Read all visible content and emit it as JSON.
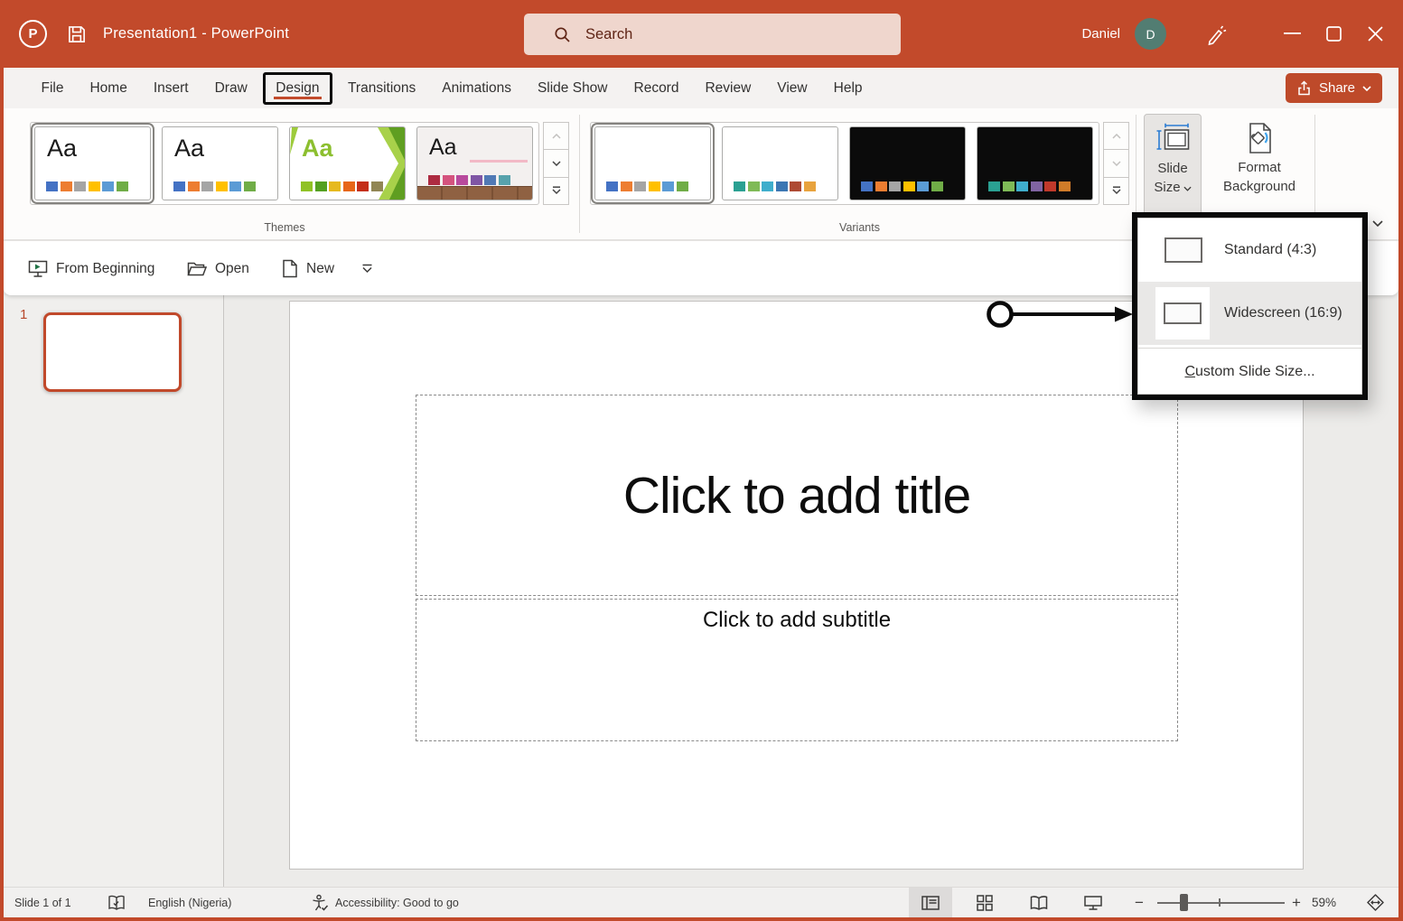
{
  "titlebar": {
    "app_title": "Presentation1  -  PowerPoint",
    "search_placeholder": "Search",
    "user_name": "Daniel",
    "user_initial": "D"
  },
  "menu": {
    "tabs": [
      {
        "label": "File"
      },
      {
        "label": "Home"
      },
      {
        "label": "Insert"
      },
      {
        "label": "Draw"
      },
      {
        "label": "Design"
      },
      {
        "label": "Transitions"
      },
      {
        "label": "Animations"
      },
      {
        "label": "Slide Show"
      },
      {
        "label": "Record"
      },
      {
        "label": "Review"
      },
      {
        "label": "View"
      },
      {
        "label": "Help"
      }
    ],
    "active_tab": "Design",
    "share_label": "Share"
  },
  "ribbon": {
    "themes_label": "Themes",
    "variants_label": "Variants",
    "theme_sample_text": "Aa",
    "themes": [
      {
        "name": "office-theme-1",
        "colors": [
          "#4472C4",
          "#ED7D31",
          "#A5A5A5",
          "#FFC000",
          "#5B9BD5",
          "#70AD47"
        ]
      },
      {
        "name": "office-theme-2",
        "colors": [
          "#4472C4",
          "#ED7D31",
          "#A5A5A5",
          "#FFC000",
          "#5B9BD5",
          "#70AD47"
        ]
      },
      {
        "name": "facet-theme",
        "colors": [
          "#90C226",
          "#54A021",
          "#E6B91E",
          "#E76618",
          "#C42F1A",
          "#918655"
        ]
      },
      {
        "name": "gallery-theme",
        "colors": [
          "#AD2B41",
          "#D4537E",
          "#B84A9D",
          "#7F56A5",
          "#5079B5",
          "#57A2AC"
        ]
      }
    ],
    "variants": [
      {
        "bg": "#FFFFFF",
        "colors": [
          "#4472C4",
          "#ED7D31",
          "#A5A5A5",
          "#FFC000",
          "#5B9BD5",
          "#70AD47"
        ]
      },
      {
        "bg": "#FFFFFF",
        "colors": [
          "#2AA092",
          "#7FBA57",
          "#3FAECC",
          "#3C77B3",
          "#AE4A33",
          "#E8A33D"
        ]
      },
      {
        "bg": "#0B0B0B",
        "colors": [
          "#4472C4",
          "#ED7D31",
          "#A5A5A5",
          "#FFC000",
          "#5B9BD5",
          "#70AD47"
        ]
      },
      {
        "bg": "#0B0B0B",
        "colors": [
          "#2AA092",
          "#7FBA57",
          "#3FAECC",
          "#8064A2",
          "#C0392B",
          "#CF7B29"
        ]
      }
    ],
    "slide_size_line1": "Slide",
    "slide_size_line2": "Size",
    "format_background_line1": "Format",
    "format_background_line2": "Background"
  },
  "quick_access": {
    "from_beginning_label": "From Beginning",
    "open_label": "Open",
    "new_label": "New"
  },
  "slide_size_menu": {
    "standard_label": "Standard (4:3)",
    "widescreen_label": "Widescreen (16:9)",
    "custom_prefix": "C",
    "custom_rest": "ustom Slide Size..."
  },
  "thumbnail_panel": {
    "slide_number": "1"
  },
  "slide": {
    "title_placeholder": "Click to add title",
    "subtitle_placeholder": "Click to add subtitle"
  },
  "status_bar": {
    "slide_counter": "Slide 1 of 1",
    "language": "English (Nigeria)",
    "accessibility": "Accessibility: Good to go",
    "zoom_level": "59%"
  },
  "colors": {
    "brand_red": "#C24A2B",
    "selection_orange": "#C1492B",
    "avatar_teal": "#527D72"
  }
}
